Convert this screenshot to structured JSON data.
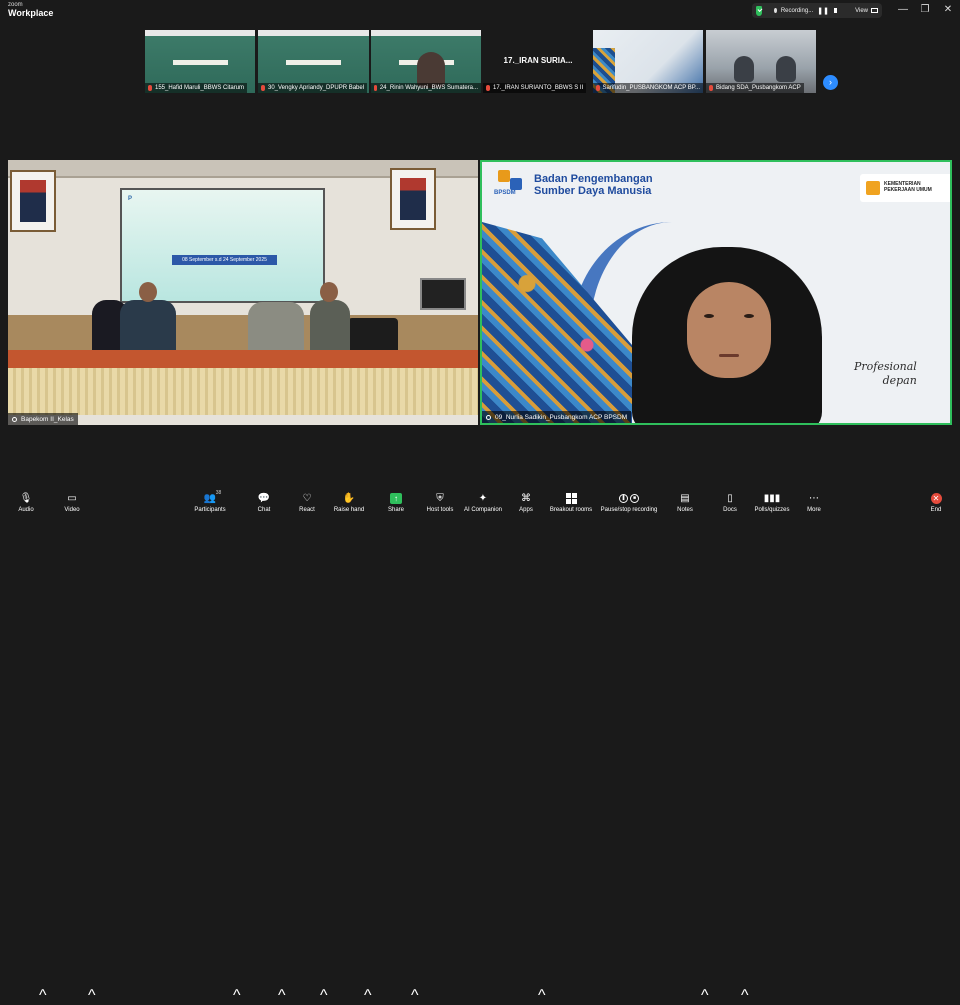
{
  "app": {
    "logo_line1": "zoom",
    "logo_line2": "Workplace"
  },
  "recording": {
    "status": "Recording...",
    "view_label": "View"
  },
  "window_controls": {
    "minimize": "—",
    "restore": "❐",
    "close": "✕"
  },
  "thumbnails": [
    {
      "name": "155_Hafid Maruli_BBWS Citarum",
      "kind": "slide"
    },
    {
      "name": "30_Vengky Apriandy_DPUPR Babel",
      "kind": "slide"
    },
    {
      "name": "24_Rinin Wahyuni_BWS Sumatera...",
      "kind": "slide-person"
    },
    {
      "name": "17._IRAN SURIANTO_BBWS S II",
      "kind": "blank",
      "center_text": "17._IRAN SURIA..."
    },
    {
      "name": "Sarifudin_PUSBANGKOM ACP BP...",
      "kind": "bpsdm"
    },
    {
      "name": "Bidang SDA_Pusbangkom ACP",
      "kind": "office"
    }
  ],
  "main_tiles": {
    "room": {
      "name": "Bapekom II_Kelas",
      "screen_date": "08 September s.d 24 September 2025"
    },
    "speaker": {
      "name": "09_Nurlia Sadikin_Pusbangkom ACP BPSDM",
      "org_acronym": "BPSDM",
      "org_line1": "Badan Pengembangan",
      "org_line2": "Sumber Daya Manusia",
      "ministry_line1": "KEMENTERIAN",
      "ministry_line2": "PEKERJAAN UMUM",
      "slogan_line1": "Profesional",
      "slogan_line2": "depan"
    }
  },
  "toolbar": {
    "participants_count": "38",
    "items": [
      {
        "label": "Audio",
        "icon": "microphone-icon"
      },
      {
        "label": "Video",
        "icon": "video-camera-icon"
      },
      {
        "label": "Participants",
        "icon": "participants-icon"
      },
      {
        "label": "Chat",
        "icon": "chat-icon"
      },
      {
        "label": "React",
        "icon": "heart-icon"
      },
      {
        "label": "Raise hand",
        "icon": "hand-icon"
      },
      {
        "label": "Share",
        "icon": "share-icon"
      },
      {
        "label": "Host tools",
        "icon": "shield-icon"
      },
      {
        "label": "AI Companion",
        "icon": "sparkle-icon"
      },
      {
        "label": "Apps",
        "icon": "apps-icon"
      },
      {
        "label": "Breakout rooms",
        "icon": "grid-icon"
      },
      {
        "label": "Pause/stop recording",
        "icon": "record-icon"
      },
      {
        "label": "Notes",
        "icon": "notes-icon"
      },
      {
        "label": "Docs",
        "icon": "docs-icon"
      },
      {
        "label": "Polls/quizzes",
        "icon": "poll-icon"
      },
      {
        "label": "More",
        "icon": "more-icon"
      },
      {
        "label": "End",
        "icon": "end-icon"
      }
    ]
  },
  "colors": {
    "accent": "#2d8cff",
    "active_speaker": "#2fbf5c",
    "end": "#e54b3c"
  }
}
